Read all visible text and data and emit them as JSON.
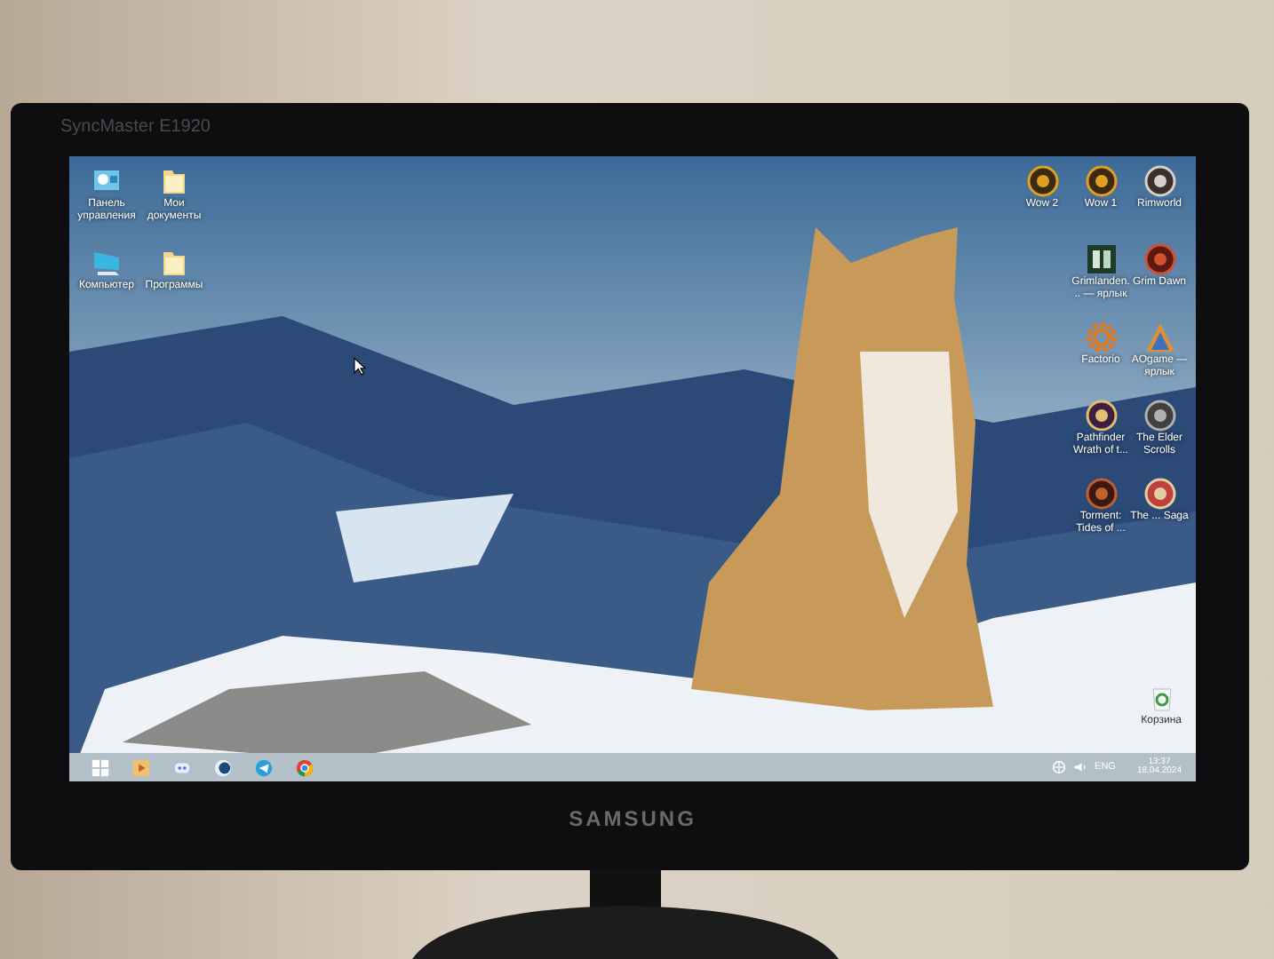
{
  "monitor": {
    "model": "SyncMaster E1920",
    "brand": "SAMSUNG"
  },
  "desktop": {
    "left_icons": [
      {
        "label": "Панель управления",
        "kind": "panel"
      },
      {
        "label": "Мои документы",
        "kind": "folder"
      },
      {
        "label": "Компьютер",
        "kind": "computer"
      },
      {
        "label": "Программы",
        "kind": "folder"
      }
    ],
    "right_icons": [
      {
        "label": "Wow 2",
        "kind": "wow"
      },
      {
        "label": "Wow 1",
        "kind": "wow"
      },
      {
        "label": "Rimworld",
        "kind": "rim"
      },
      {
        "label": "Grimlanden... — ярлык",
        "kind": "tile"
      },
      {
        "label": "Grim Dawn",
        "kind": "dawn"
      },
      {
        "label": "Factorio",
        "kind": "gear"
      },
      {
        "label": "AOgame — ярлык",
        "kind": "tri"
      },
      {
        "label": "Pathfinder Wrath of t...",
        "kind": "path"
      },
      {
        "label": "The Elder Scrolls",
        "kind": "ring"
      },
      {
        "label": "Torment: Tides of ...",
        "kind": "torment"
      },
      {
        "label": "The ... Saga",
        "kind": "saga"
      }
    ],
    "recycle_bin": {
      "label": "Корзина"
    }
  },
  "taskbar": {
    "language": "ENG",
    "time": "13:37",
    "date": "18.04.2024"
  }
}
